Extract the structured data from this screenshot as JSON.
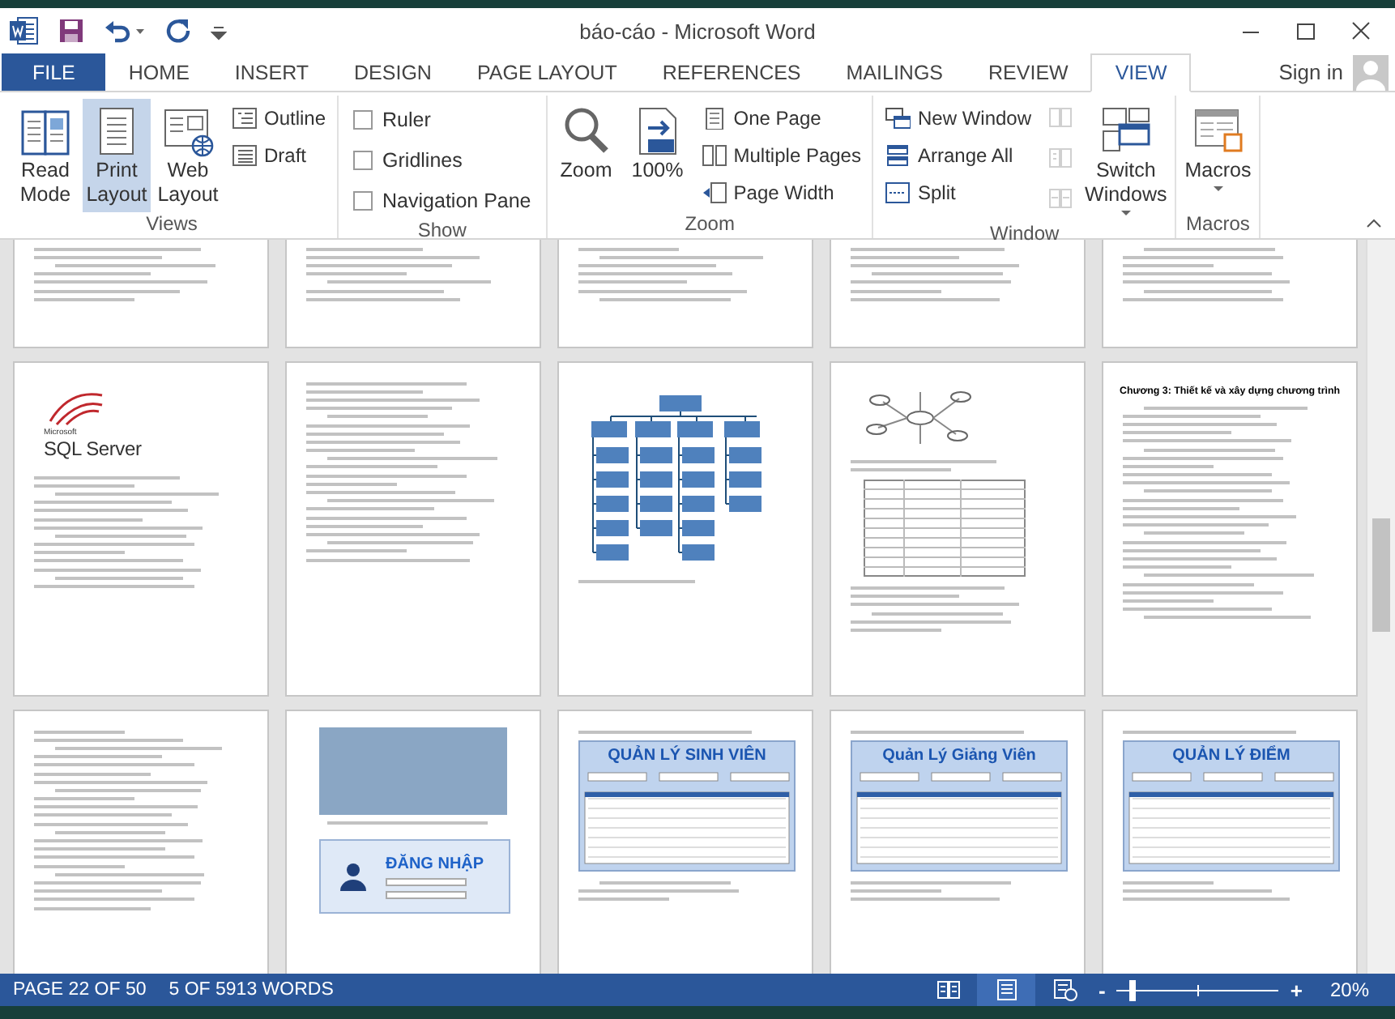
{
  "title_bar": {
    "title": "báo-cáo - Microsoft Word"
  },
  "ribbon_tabs": [
    {
      "label": "FILE",
      "kind": "file",
      "selected": false
    },
    {
      "label": "HOME",
      "kind": "tab",
      "selected": false
    },
    {
      "label": "INSERT",
      "kind": "tab",
      "selected": false
    },
    {
      "label": "DESIGN",
      "kind": "tab",
      "selected": false
    },
    {
      "label": "PAGE LAYOUT",
      "kind": "tab",
      "selected": false
    },
    {
      "label": "REFERENCES",
      "kind": "tab",
      "selected": false
    },
    {
      "label": "MAILINGS",
      "kind": "tab",
      "selected": false
    },
    {
      "label": "REVIEW",
      "kind": "tab",
      "selected": false
    },
    {
      "label": "VIEW",
      "kind": "tab",
      "selected": true
    }
  ],
  "account": {
    "label": "Sign in"
  },
  "ribbon_groups": [
    {
      "label": "Views",
      "items": [
        {
          "kind": "large",
          "label": "Read Mode",
          "selected": false
        },
        {
          "kind": "large",
          "label": "Print Layout",
          "selected": true
        },
        {
          "kind": "large",
          "label": "Web Layout",
          "selected": false
        },
        {
          "kind": "small",
          "label": "Outline",
          "selected": false
        },
        {
          "kind": "small",
          "label": "Draft",
          "selected": false
        }
      ]
    },
    {
      "label": "Show",
      "items": [
        {
          "kind": "check",
          "label": "Ruler",
          "checked": false
        },
        {
          "kind": "check",
          "label": "Gridlines",
          "checked": false
        },
        {
          "kind": "check",
          "label": "Navigation Pane",
          "checked": false
        }
      ]
    },
    {
      "label": "Zoom",
      "items": [
        {
          "kind": "large",
          "label": "Zoom"
        },
        {
          "kind": "large",
          "label": "100%"
        },
        {
          "kind": "small",
          "label": "One Page"
        },
        {
          "kind": "small",
          "label": "Multiple Pages"
        },
        {
          "kind": "small",
          "label": "Page Width"
        }
      ]
    },
    {
      "label": "Window",
      "items": [
        {
          "kind": "small",
          "label": "New Window"
        },
        {
          "kind": "small",
          "label": "Arrange All"
        },
        {
          "kind": "small",
          "label": "Split"
        },
        {
          "kind": "icon",
          "disabled": true
        },
        {
          "kind": "icon",
          "disabled": true
        },
        {
          "kind": "icon",
          "disabled": true
        },
        {
          "kind": "large",
          "label": "Switch Windows",
          "dropdown": true
        }
      ]
    },
    {
      "label": "Macros",
      "items": [
        {
          "kind": "large",
          "label": "Macros",
          "dropdown": true
        }
      ]
    }
  ],
  "pages": [
    {
      "kind": "text"
    },
    {
      "kind": "text"
    },
    {
      "kind": "text"
    },
    {
      "kind": "text"
    },
    {
      "kind": "text"
    },
    {
      "kind": "logo",
      "brand": "Microsoft",
      "product": "SQL Server"
    },
    {
      "kind": "text"
    },
    {
      "kind": "orgchart"
    },
    {
      "kind": "diagram"
    },
    {
      "kind": "chapter",
      "heading": "Chương 3: Thiết kế và xây dựng chương trình"
    },
    {
      "kind": "text"
    },
    {
      "kind": "login",
      "title": "ĐĂNG NHẬP"
    },
    {
      "kind": "app",
      "title": "QUẢN LÝ SINH VIÊN"
    },
    {
      "kind": "app",
      "title": "Quản Lý Giảng Viên"
    },
    {
      "kind": "app",
      "title": "QUẢN LÝ ĐIỂM"
    }
  ],
  "status_bar": {
    "page": "PAGE 22 OF 50",
    "words": "5 OF 5913 WORDS",
    "views": [
      {
        "selected": false
      },
      {
        "selected": true
      },
      {
        "selected": false
      }
    ],
    "zoom": {
      "minus": "-",
      "plus": "+",
      "level": 0.08,
      "reading": "20%"
    }
  }
}
